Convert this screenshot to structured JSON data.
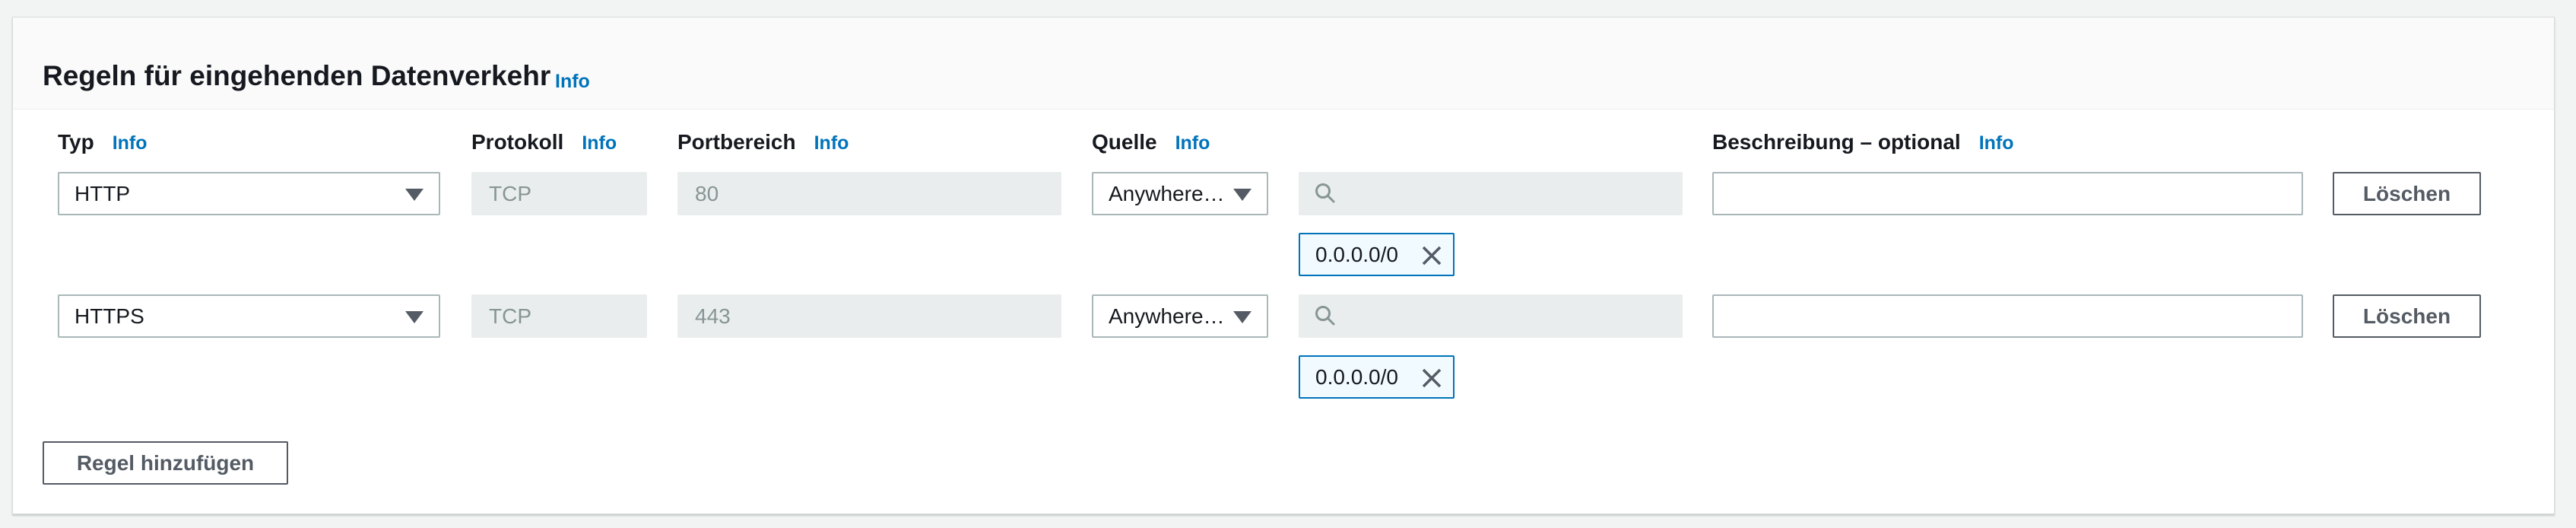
{
  "section": {
    "title": "Regeln für eingehenden Datenverkehr",
    "info_label": "Info"
  },
  "columns": {
    "type": {
      "label": "Typ",
      "info": "Info"
    },
    "protocol": {
      "label": "Protokoll",
      "info": "Info"
    },
    "port_range": {
      "label": "Portbereich",
      "info": "Info"
    },
    "source": {
      "label": "Quelle",
      "info": "Info"
    },
    "description": {
      "label": "Beschreibung – optional",
      "info": "Info"
    }
  },
  "rules": [
    {
      "type": "HTTP",
      "protocol": "TCP",
      "port_range": "80",
      "source_mode": "Anywhere…",
      "search_value": "",
      "source_token": "0.0.0.0/0",
      "description": "",
      "delete_label": "Löschen"
    },
    {
      "type": "HTTPS",
      "protocol": "TCP",
      "port_range": "443",
      "source_mode": "Anywhere…",
      "search_value": "",
      "source_token": "0.0.0.0/0",
      "description": "",
      "delete_label": "Löschen"
    }
  ],
  "add_rule_label": "Regel hinzufügen",
  "icons": {
    "search": "search-icon",
    "remove": "close-icon",
    "dropdown": "caret-down-icon"
  },
  "colors": {
    "info_link": "#0073bb",
    "token_border": "#0073bb",
    "token_bg": "#f1faff",
    "disabled_bg": "#eaeded"
  }
}
